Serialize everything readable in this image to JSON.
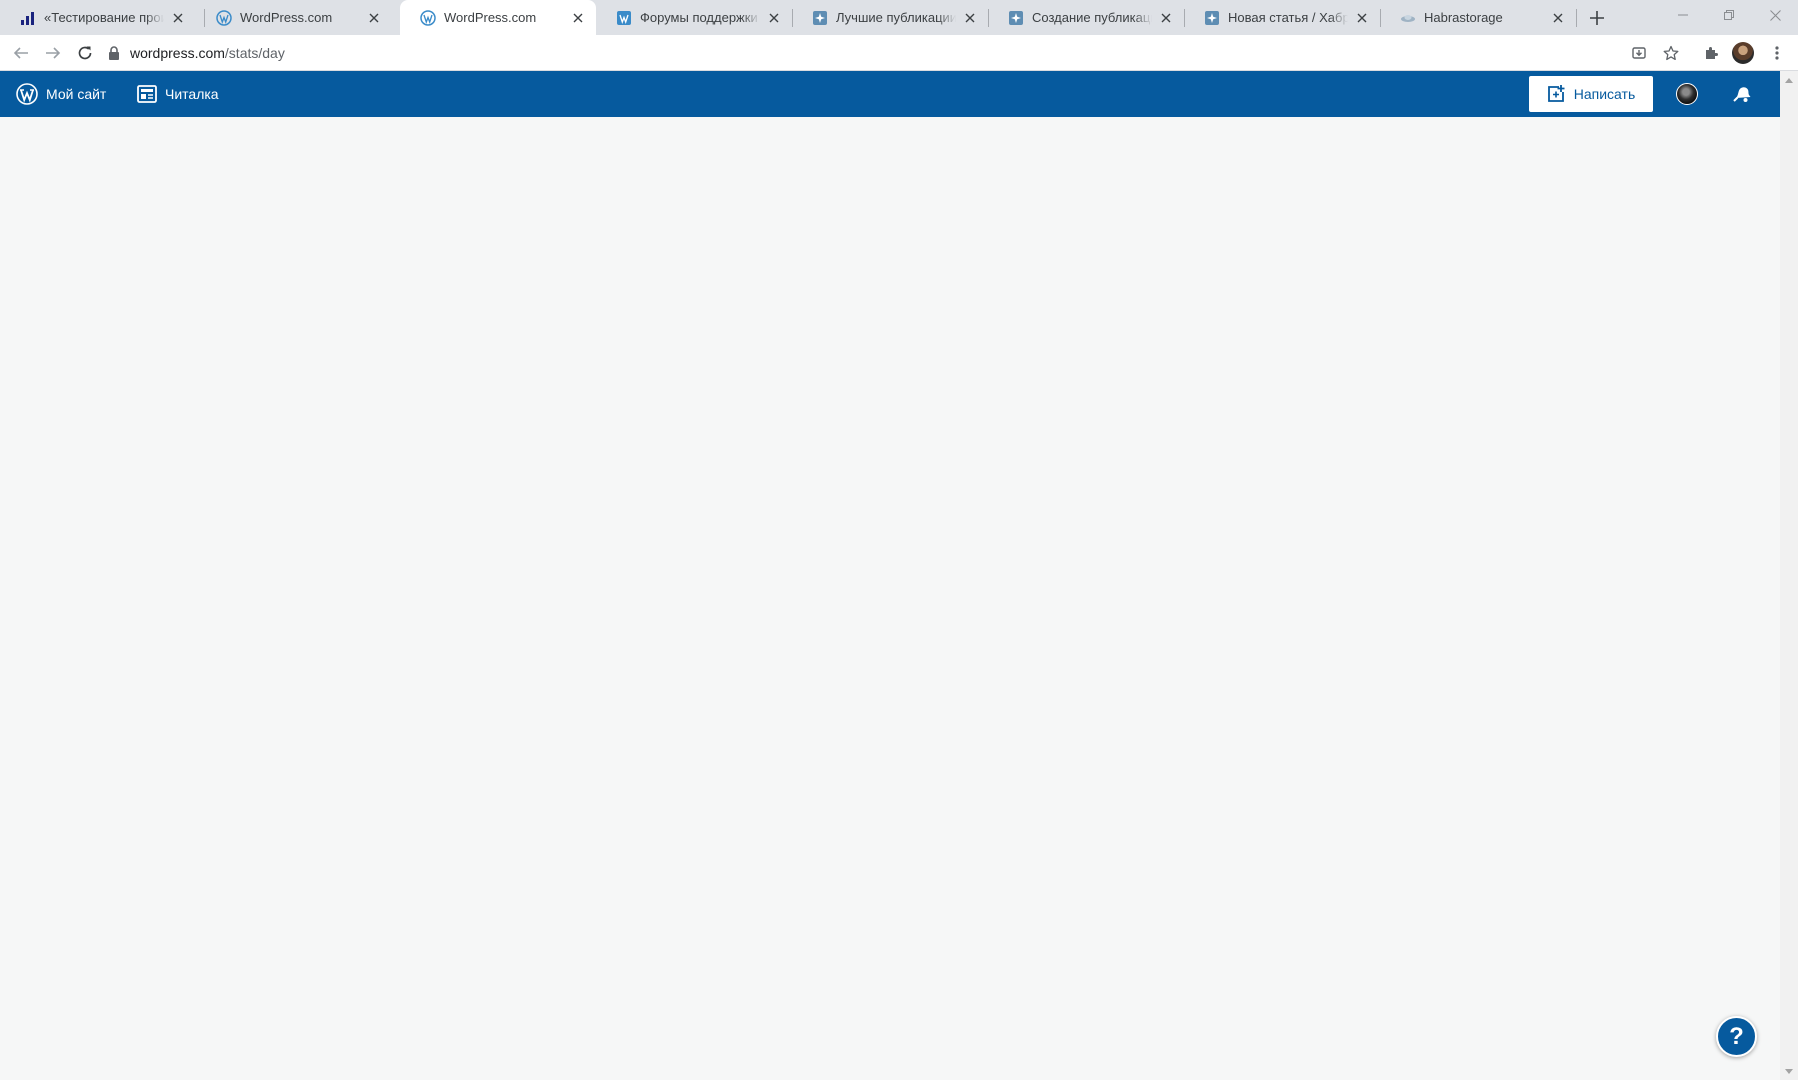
{
  "browser": {
    "tabs": [
      {
        "title": "«Тестирование производительности",
        "icon": "bar-chart-icon",
        "active": false
      },
      {
        "title": "WordPress.com",
        "icon": "wordpress-icon",
        "active": false
      },
      {
        "title": "WordPress.com",
        "icon": "wordpress-icon",
        "active": true
      },
      {
        "title": "Форумы поддержки",
        "icon": "wordpress-icon",
        "active": false
      },
      {
        "title": "Лучшие публикации за сутки",
        "icon": "habr-icon",
        "active": false
      },
      {
        "title": "Создание публикации / Хабр",
        "icon": "habr-icon",
        "active": false
      },
      {
        "title": "Новая статья / Хабр",
        "icon": "habr-icon",
        "active": false
      },
      {
        "title": "Habrastorage",
        "icon": "habrastorage-icon",
        "active": false
      }
    ],
    "url_host": "wordpress.com",
    "url_path": "/stats/day"
  },
  "masterbar": {
    "my_site_label": "Мой сайт",
    "reader_label": "Читалка",
    "write_label": "Написать"
  },
  "help": {
    "label": "?"
  },
  "colors": {
    "brand_blue": "#065a9e",
    "page_bg": "#f6f7f7",
    "tabstrip_bg": "#dee1e6"
  }
}
